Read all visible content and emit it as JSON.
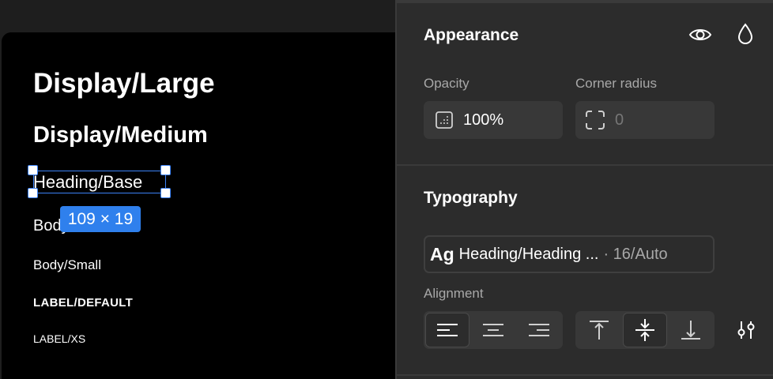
{
  "canvas": {
    "samples": [
      "Display/Large",
      "Display/Medium",
      "Heading/Base",
      "Body/",
      "Body/Small",
      "LABEL/DEFAULT",
      "LABEL/XS"
    ],
    "selection_size": "109 × 19"
  },
  "panel": {
    "appearance": {
      "title": "Appearance",
      "opacity_label": "Opacity",
      "opacity_value": "100%",
      "radius_label": "Corner radius",
      "radius_value": "0",
      "icons": [
        "eye-icon",
        "drop-icon"
      ]
    },
    "typography": {
      "title": "Typography",
      "style_prefix": "Ag",
      "style_name": "Heading/Heading ...",
      "style_meta": "· 16/Auto",
      "alignment_label": "Alignment",
      "horizontal_align": [
        "align-left-icon",
        "align-center-icon",
        "align-right-icon"
      ],
      "horizontal_selected": "align-left",
      "vertical_align": [
        "align-top-icon",
        "align-middle-icon",
        "align-bottom-icon"
      ],
      "vertical_selected": "align-middle"
    }
  },
  "colors": {
    "accent": "#2f80ed",
    "panel_bg": "#2c2c2c",
    "field_bg": "#383838",
    "canvas_frame": "#000000"
  }
}
